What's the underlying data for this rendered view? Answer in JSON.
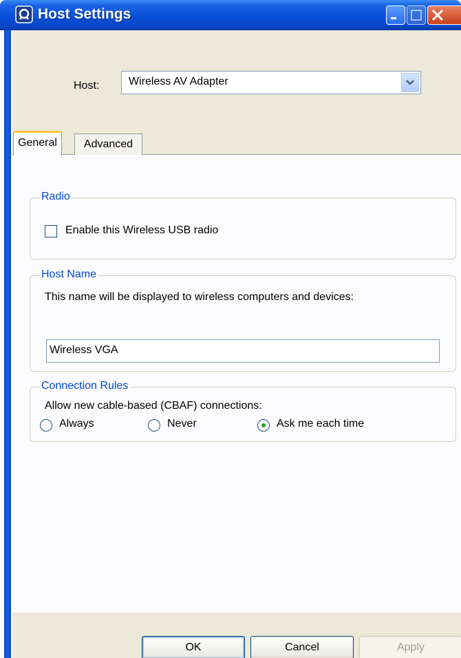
{
  "window": {
    "title": "Host Settings",
    "accent": "#0a47c8",
    "close_color": "#c8401c"
  },
  "host": {
    "label": "Host:",
    "selected": "Wireless AV Adapter"
  },
  "tabs": [
    {
      "label": "General",
      "active": true
    },
    {
      "label": "Advanced",
      "active": false
    }
  ],
  "radio_group": {
    "title": "Radio",
    "checkbox_label": "Enable this Wireless USB radio",
    "checked": false
  },
  "host_name": {
    "title": "Host Name",
    "description": "This name will be displayed to wireless computers and devices:",
    "value": "Wireless VGA"
  },
  "connection_rules": {
    "title": "Connection Rules",
    "prompt": "Allow new cable-based (CBAF) connections:",
    "options": [
      {
        "label": "Always",
        "selected": false
      },
      {
        "label": "Never",
        "selected": false
      },
      {
        "label": "Ask me each time",
        "selected": true
      }
    ],
    "selected_color": "#21a121"
  },
  "buttons": {
    "ok": "OK",
    "cancel": "Cancel",
    "apply": "Apply",
    "apply_enabled": false
  }
}
